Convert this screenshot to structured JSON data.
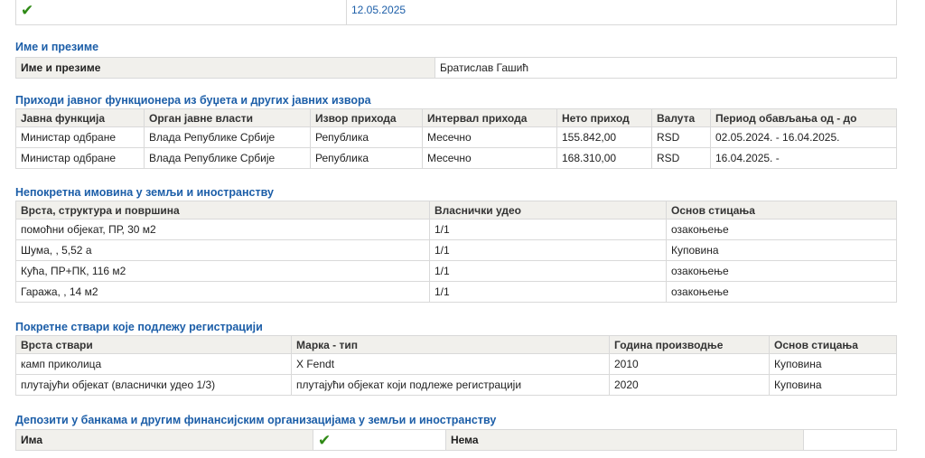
{
  "top_row": {
    "check": "✔",
    "date": "12.05.2025"
  },
  "name_section": {
    "title": "Име и презиме",
    "label": "Име и презиме",
    "value": "Братислав Гашић"
  },
  "income": {
    "title": "Приходи јавног функционера из буџета и других јавних извора",
    "headers": [
      "Јавна функција",
      "Орган јавне власти",
      "Извор прихода",
      "Интервал прихода",
      "Нето приход",
      "Валута",
      "Период обављања од - до"
    ],
    "rows": [
      [
        "Министар одбране",
        "Влада Републике Србије",
        "Република",
        "Месечно",
        "155.842,00",
        "RSD",
        "02.05.2024. - 16.04.2025."
      ],
      [
        "Министар одбране",
        "Влада Републике Србије",
        "Република",
        "Месечно",
        "168.310,00",
        "RSD",
        "16.04.2025. -"
      ]
    ]
  },
  "real_estate": {
    "title": "Непокретна имовина у земљи и иностранству",
    "headers": [
      "Врста, структура и површина",
      "Власнички удео",
      "Основ стицања"
    ],
    "rows": [
      [
        "помоћни објекат, ПР, 30 м2",
        "1/1",
        "озакоњење"
      ],
      [
        "Шума, , 5,52 а",
        "1/1",
        "Куповина"
      ],
      [
        "Кућа, ПР+ПК, 116 м2",
        "1/1",
        "озакоњење"
      ],
      [
        "Гаража, , 14 м2",
        "1/1",
        "озакоњење"
      ]
    ]
  },
  "movables": {
    "title": "Покретне ствари које подлежу регистрацији",
    "headers": [
      "Врста ствари",
      "Марка - тип",
      "Година производње",
      "Основ стицања"
    ],
    "rows": [
      [
        "камп приколица",
        "X Fendt",
        "2010",
        "Куповина"
      ],
      [
        "плутајући објекат (власнички удео 1/3)",
        "плутајући објекат који подлеже регистрацији",
        "2020",
        "Куповина"
      ]
    ]
  },
  "deposits": {
    "title": "Депозити у банкама и другим финансијским организацијама у земљи и иностранству",
    "has_label": "Има",
    "has_value": "✔",
    "none_label": "Нема",
    "none_value": ""
  }
}
